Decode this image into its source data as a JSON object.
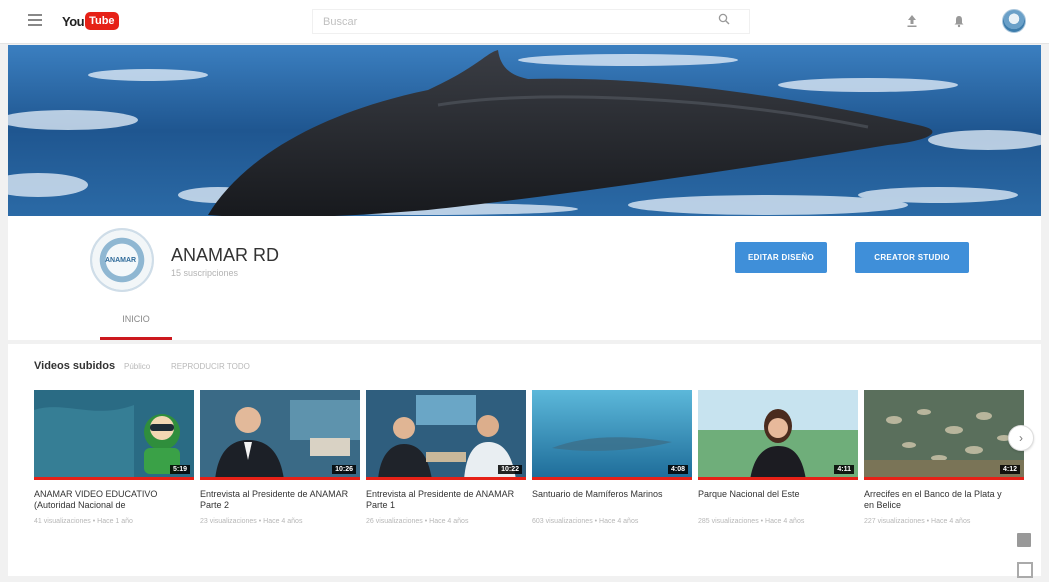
{
  "masthead": {
    "logo_you": "You",
    "logo_tube": "Tube",
    "search_placeholder": "Buscar"
  },
  "channel": {
    "name": "ANAMAR RD",
    "subscriptions": "15 suscripciones",
    "avatar_text": "ANAMAR",
    "buttons": {
      "edit_design": "EDITAR DISEÑO",
      "creator_studio": "CREATOR STUDIO"
    },
    "tabs": [
      {
        "label": "INICIO"
      }
    ]
  },
  "section": {
    "title": "Videos subidos",
    "meta": "Público",
    "play_all": "REPRODUCIR TODO"
  },
  "videos": [
    {
      "title": "ANAMAR VIDEO EDUCATIVO (Autoridad Nacional de",
      "meta": "41 visualizaciones • Hace 1 año",
      "duration": "5:19"
    },
    {
      "title": "Entrevista al Presidente de ANAMAR Parte 2",
      "meta": "23 visualizaciones • Hace 4 años",
      "duration": "10:26"
    },
    {
      "title": "Entrevista al Presidente de ANAMAR Parte 1",
      "meta": "26 visualizaciones • Hace 4 años",
      "duration": "10:22"
    },
    {
      "title": "Santuario de Mamíferos Marinos",
      "meta": "603 visualizaciones • Hace 4 años",
      "duration": "4:08"
    },
    {
      "title": "Parque Nacional del Este",
      "meta": "285 visualizaciones • Hace 4 años",
      "duration": "4:11"
    },
    {
      "title": "Arrecifes en el Banco de la Plata y en Belice",
      "meta": "227 visualizaciones • Hace 4 años",
      "duration": "4:12"
    }
  ],
  "colors": {
    "brand_red": "#e62117",
    "button_blue": "#3f8fd9"
  }
}
